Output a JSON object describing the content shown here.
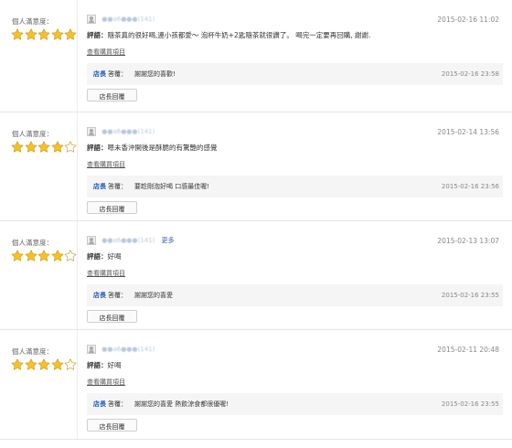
{
  "colors": {
    "star_fill": "#fbbf24",
    "star_empty": "#ffffff",
    "star_stroke": "#c9a227",
    "link": "#2a63b8",
    "owner": "#1a56b4"
  },
  "reviews": [
    {
      "satisfaction_label": "個人滿意度：",
      "rating": 5,
      "username": "●●a6●●●(141)",
      "more": "",
      "date": "2015-02-16 11:02",
      "comment_label": "評語：",
      "comment": "隨茶真的很好喝,連小孩都愛～ 泡杯牛奶+2匙隨茶就很讚了。 喝完一定要再回購, 謝謝.",
      "purchase_link": "查看購買項目",
      "reply": {
        "owner": "店長",
        "label": "答覆：",
        "text": "謝謝您的喜歡!",
        "date": "2015-02-16 23:58"
      },
      "reply_button": "店長回覆"
    },
    {
      "satisfaction_label": "個人滿意度：",
      "rating": 4,
      "username": "●●a6●●●(141)",
      "more": "",
      "date": "2015-02-14 13:56",
      "comment_label": "評語：",
      "comment": "嗯未香沖開後是酥脆的有驚艷的感覺",
      "purchase_link": "查看購買項目",
      "reply": {
        "owner": "店長",
        "label": "答覆：",
        "text": "要趁剛泡好喝 口感最佳喔!",
        "date": "2015-02-16 23:56"
      },
      "reply_button": "店長回覆"
    },
    {
      "satisfaction_label": "個人滿意度：",
      "rating": 4,
      "username": "●●a6●●●(141)",
      "more": "更多",
      "date": "2015-02-13 13:07",
      "comment_label": "評語：",
      "comment": "好喝",
      "purchase_link": "查看購買項目",
      "reply": {
        "owner": "店長",
        "label": "答覆：",
        "text": "謝謝您的喜愛",
        "date": "2015-02-16 23:55"
      },
      "reply_button": "店長回覆"
    },
    {
      "satisfaction_label": "個人滿意度：",
      "rating": 4,
      "username": "●●a6●●●(141)",
      "more": "",
      "date": "2015-02-11 20:48",
      "comment_label": "評語：",
      "comment": "好喝",
      "purchase_link": "查看購買項目",
      "reply": {
        "owner": "店長",
        "label": "答覆：",
        "text": "謝謝您的喜愛 熱飲涼食都很優喔!",
        "date": "2015-02-16 23:55"
      },
      "reply_button": "店長回覆"
    }
  ]
}
